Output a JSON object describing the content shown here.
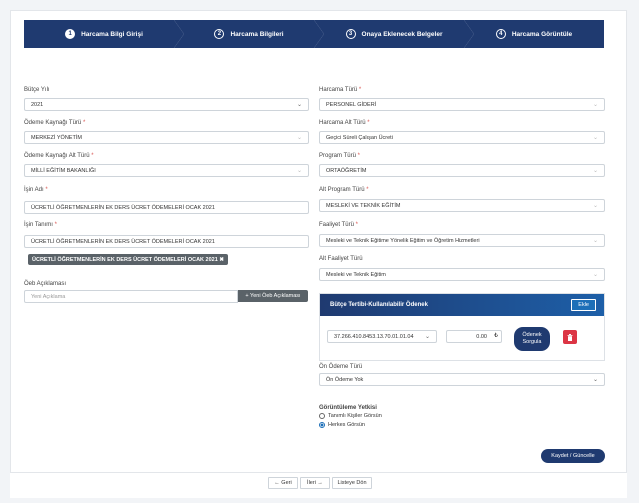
{
  "steps": [
    {
      "num": "1",
      "label": "Harcama Bilgi Girişi"
    },
    {
      "num": "2",
      "label": "Harcama Bilgileri"
    },
    {
      "num": "3",
      "label": "Onaya Eklenecek Belgeler"
    },
    {
      "num": "4",
      "label": "Harcama Görüntüle"
    }
  ],
  "left": {
    "butce_yili": {
      "label": "Bütçe Yılı",
      "value": "2021"
    },
    "odeme_kaynagi_turu": {
      "label": "Ödeme Kaynağı Türü",
      "req": "*",
      "value": "MERKEZİ YÖNETİM"
    },
    "odeme_kaynagi_alt_turu": {
      "label": "Ödeme Kaynağı Alt Türü",
      "req": "*",
      "value": "MİLLİ EĞİTİM BAKANLIĞI"
    },
    "isin_adi": {
      "label": "İşin Adı",
      "req": "*",
      "value": "ÜCRETLİ ÖĞRETMENLERİN EK DERS ÜCRET ÖDEMELERİ OCAK 2021"
    },
    "isin_tanimi": {
      "label": "İşin Tanımı",
      "req": "*",
      "value": "ÜCRETLİ ÖĞRETMENLERİN EK DERS ÜCRET ÖDEMELERİ OCAK 2021"
    },
    "tag": "ÜCRETLİ ÖĞRETMENLERİN EK DERS ÜCRET ÖDEMELERİ OCAK 2021 ✖",
    "oeb": {
      "label": "Öeb Açıklaması",
      "placeholder": "Yeni Açıklama",
      "button": "+ Yeni Öeb Açıklaması"
    }
  },
  "right": {
    "harcama_turu": {
      "label": "Harcama Türü",
      "req": "*",
      "value": "PERSONEL GİDERİ"
    },
    "harcama_alt_turu": {
      "label": "Harcama Alt Türü",
      "req": "*",
      "value": "Geçici Süreli Çalışan Ücreti"
    },
    "program_turu": {
      "label": "Program Türü",
      "req": "*",
      "value": "ORTAÖĞRETİM"
    },
    "alt_program_turu": {
      "label": "Alt Program Türü",
      "req": "*",
      "value": "MESLEKİ VE TEKNİK EĞİTİM"
    },
    "faaliyet_turu": {
      "label": "Faaliyet Türü",
      "req": "*",
      "value": "Mesleki ve Teknik Eğitime Yönelik Eğitim ve Öğretim Hizmetleri"
    },
    "alt_faaliyet_turu": {
      "label": "Alt Faaliyet Türü",
      "value": "Mesleki ve Teknik Eğitim"
    },
    "butce_panel": {
      "title": "Bütçe Tertibi-Kullanılabilir Ödenek",
      "ekle": "Ekle",
      "tertip": "37.266.410.8453.13.70.01.01.04",
      "amount": "0.00",
      "currency": "₺",
      "odenek_line1": "Ödenek",
      "odenek_line2": "Sorgula"
    },
    "on_odeme": {
      "label": "Ön Ödeme Türü",
      "value": "Ön Ödeme Yok"
    },
    "gorunurluk": {
      "label": "Görüntüleme Yetkisi",
      "opt1": "Tanımlı Kişiler Görsün",
      "opt2": "Herkes Görsün"
    },
    "kaydet": "Kaydet / Güncelle"
  },
  "footer": {
    "geri": "← Geri",
    "ileri": "İleri →",
    "listeye": "Listeye Dön"
  }
}
